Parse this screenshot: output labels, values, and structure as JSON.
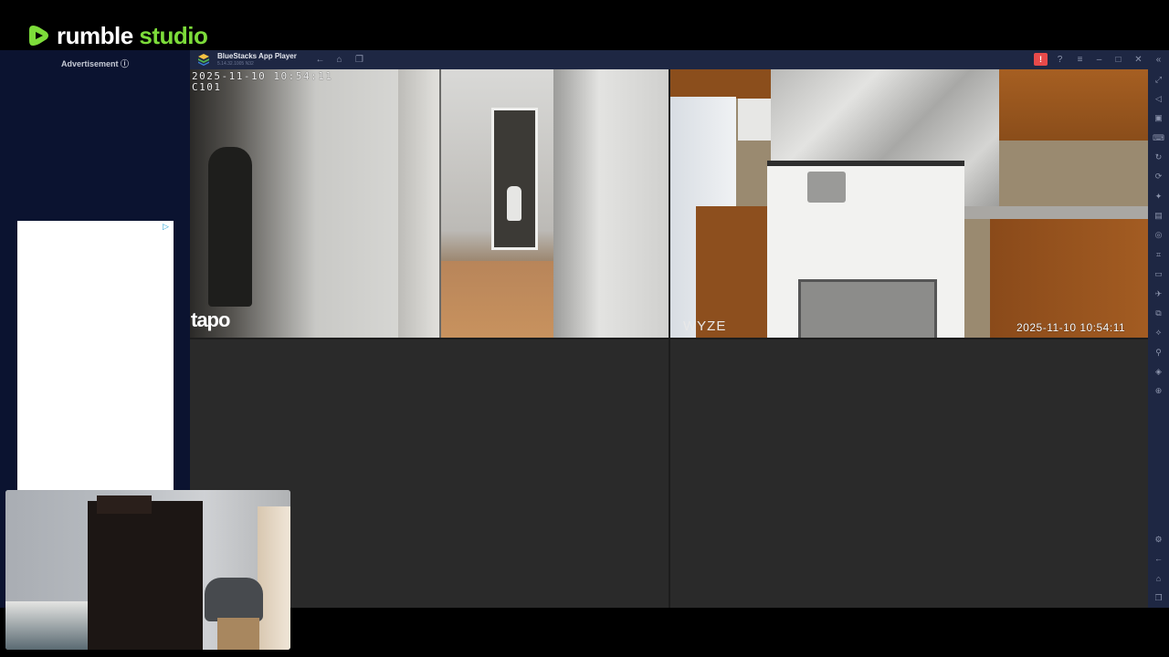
{
  "brand": {
    "name": "rumble",
    "suffix": "studio",
    "accent": "#7ddc3a"
  },
  "ad": {
    "label": "Advertisement ⓘ",
    "choice_icon": "adchoices-icon"
  },
  "bluestacks": {
    "title": "BlueStacks App Player",
    "version": "5.14.32.1005 N32",
    "toolbar_icons": [
      "back-icon",
      "home-icon",
      "recent-apps-icon"
    ],
    "window_icons": [
      "alert-icon",
      "help-icon",
      "menu-icon",
      "minimize-icon",
      "maximize-icon",
      "close-icon",
      "collapse-sidebar-icon"
    ],
    "alert_symbol": "!",
    "sidebar_icons": [
      "fullscreen-icon",
      "volume-icon",
      "media-icon",
      "keyboard-icon",
      "rotate-icon",
      "sync-icon",
      "game-controls-icon",
      "screenshot-icon",
      "camera-icon",
      "capture-icon",
      "folder-icon",
      "airplane-icon",
      "multi-instance-icon",
      "eco-mode-icon",
      "location-icon",
      "layers-icon",
      "macro-icon",
      "settings-icon",
      "back-nav-icon",
      "home-nav-icon",
      "recents-nav-icon"
    ]
  },
  "cameras": [
    {
      "id": "cam-hallway",
      "timestamp": "2025-11-10 10:54:11",
      "channel": "C101",
      "brand": "tapo"
    },
    {
      "id": "cam-kitchen",
      "timestamp": "2025-11-10  10:54:11",
      "brand": "WYZE"
    }
  ]
}
